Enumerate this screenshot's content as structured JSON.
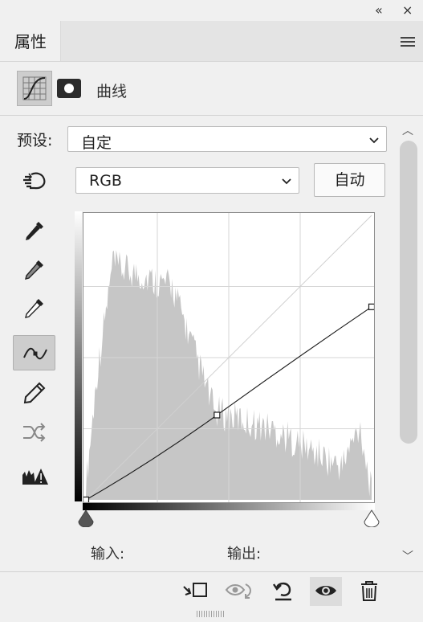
{
  "window": {
    "collapse_glyph": "«",
    "close_glyph": "×"
  },
  "tab": {
    "label": "属性"
  },
  "header": {
    "title": "曲线",
    "adjustment_icon": "curves-adjustment-icon",
    "mask_icon": "layer-mask-icon"
  },
  "preset": {
    "label": "预设:",
    "value": "自定"
  },
  "channel": {
    "value": "RGB"
  },
  "auto_button": {
    "label": "自动"
  },
  "tools": [
    {
      "name": "on-image-adjust-tool",
      "selected": false
    },
    {
      "name": "black-point-eyedropper",
      "selected": false
    },
    {
      "name": "gray-point-eyedropper",
      "selected": false
    },
    {
      "name": "white-point-eyedropper",
      "selected": false
    },
    {
      "name": "curve-point-tool",
      "selected": true
    },
    {
      "name": "pencil-draw-tool",
      "selected": false
    },
    {
      "name": "smooth-curve-tool",
      "selected": false
    },
    {
      "name": "clipping-warning-tool",
      "selected": false
    }
  ],
  "curve": {
    "points": [
      {
        "input": 0,
        "output": 0
      },
      {
        "input": 117,
        "output": 76
      },
      {
        "input": 255,
        "output": 173
      }
    ],
    "grid_divisions": 4,
    "histogram_color": "#c6c6c6"
  },
  "io": {
    "input_label": "输入:",
    "output_label": "输出:"
  },
  "footer": {
    "buttons": [
      {
        "name": "clip-to-layer-icon"
      },
      {
        "name": "view-previous-state-icon"
      },
      {
        "name": "reset-icon"
      },
      {
        "name": "visibility-eye-icon",
        "selected": true
      },
      {
        "name": "delete-trash-icon"
      }
    ]
  }
}
